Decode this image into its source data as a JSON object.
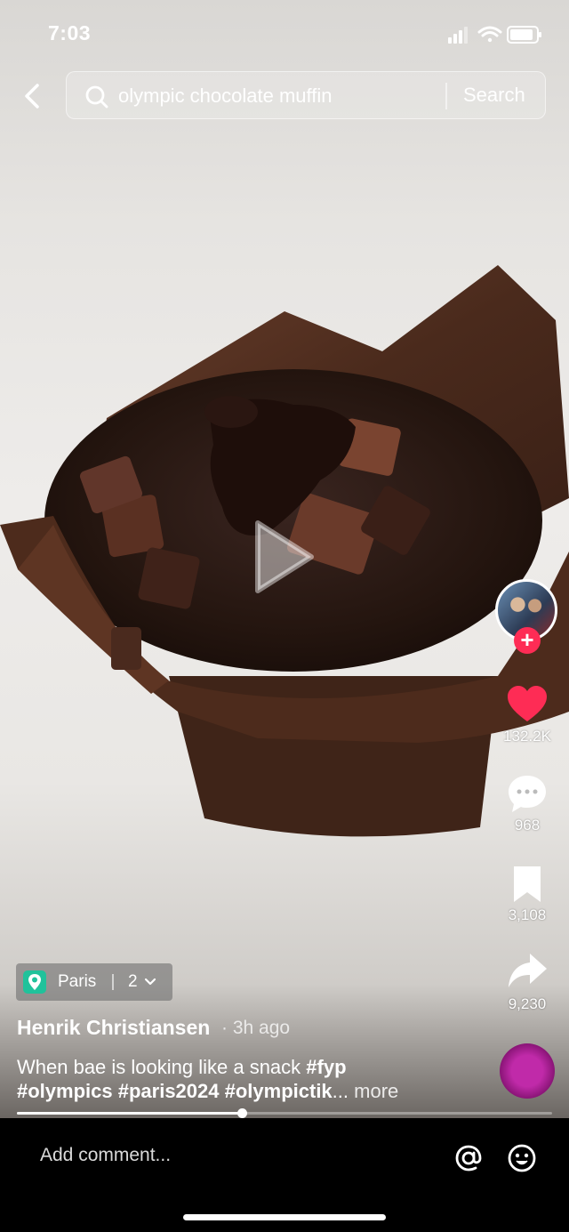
{
  "status_bar": {
    "time": "7:03"
  },
  "search": {
    "query": "olympic chocolate muffin",
    "button_label": "Search"
  },
  "creator": {
    "follow_symbol": "+"
  },
  "actions": {
    "likes": "132.2K",
    "comments": "968",
    "saves": "3,108",
    "shares": "9,230"
  },
  "location": {
    "label": "Paris",
    "count": "2"
  },
  "post": {
    "author": "Henrik Christiansen",
    "time_ago": "· 3h ago",
    "caption_text": "When bae is looking like a snack ",
    "tag_1": "#fyp",
    "tag_2": "#olympics",
    "tag_3": "#paris2024",
    "tag_4": "#olympictik",
    "ellipsis": "...",
    "more_label": " more"
  },
  "playback": {
    "progress": 0.42
  },
  "comment_bar": {
    "placeholder": "Add comment..."
  },
  "colors": {
    "accent": "#fe2c55",
    "location_pin": "#20c29b"
  }
}
